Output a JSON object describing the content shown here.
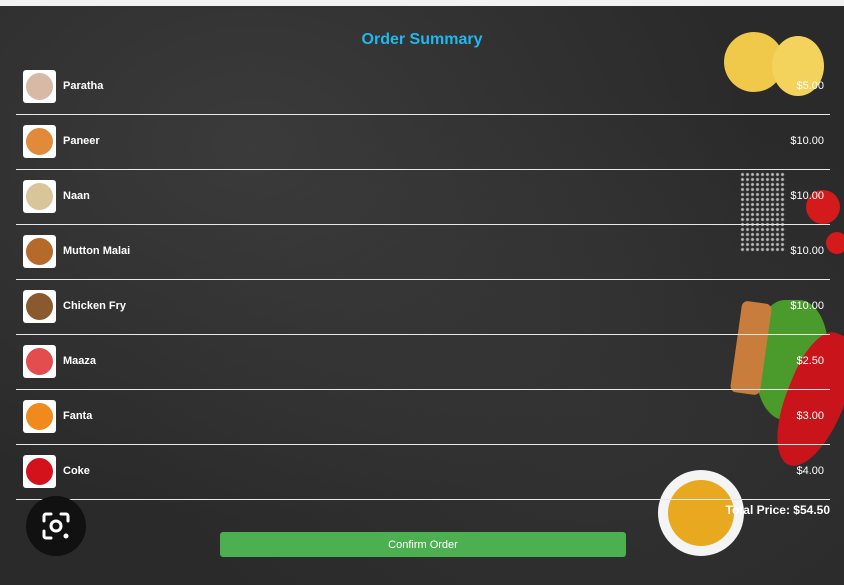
{
  "order": {
    "title": "Order Summary",
    "items": [
      {
        "name": "Paratha",
        "price": "$5.00",
        "thumb_color": "#d7b9a6"
      },
      {
        "name": "Paneer",
        "price": "$10.00",
        "thumb_color": "#e08a3a"
      },
      {
        "name": "Naan",
        "price": "$10.00",
        "thumb_color": "#d9c59a"
      },
      {
        "name": "Mutton Malai",
        "price": "$10.00",
        "thumb_color": "#b56a2c"
      },
      {
        "name": "Chicken Fry",
        "price": "$10.00",
        "thumb_color": "#8a5a2e"
      },
      {
        "name": "Maaza",
        "price": "$2.50",
        "thumb_color": "#e44d4d"
      },
      {
        "name": "Fanta",
        "price": "$3.00",
        "thumb_color": "#f08a1c"
      },
      {
        "name": "Coke",
        "price": "$4.00",
        "thumb_color": "#d3121b"
      }
    ],
    "total_text": "Total Price: $54.50",
    "confirm_label": "Confirm Order"
  },
  "colors": {
    "title": "#1fb8ef",
    "confirm_button": "#4caf50",
    "background": "#2a2a2a"
  }
}
